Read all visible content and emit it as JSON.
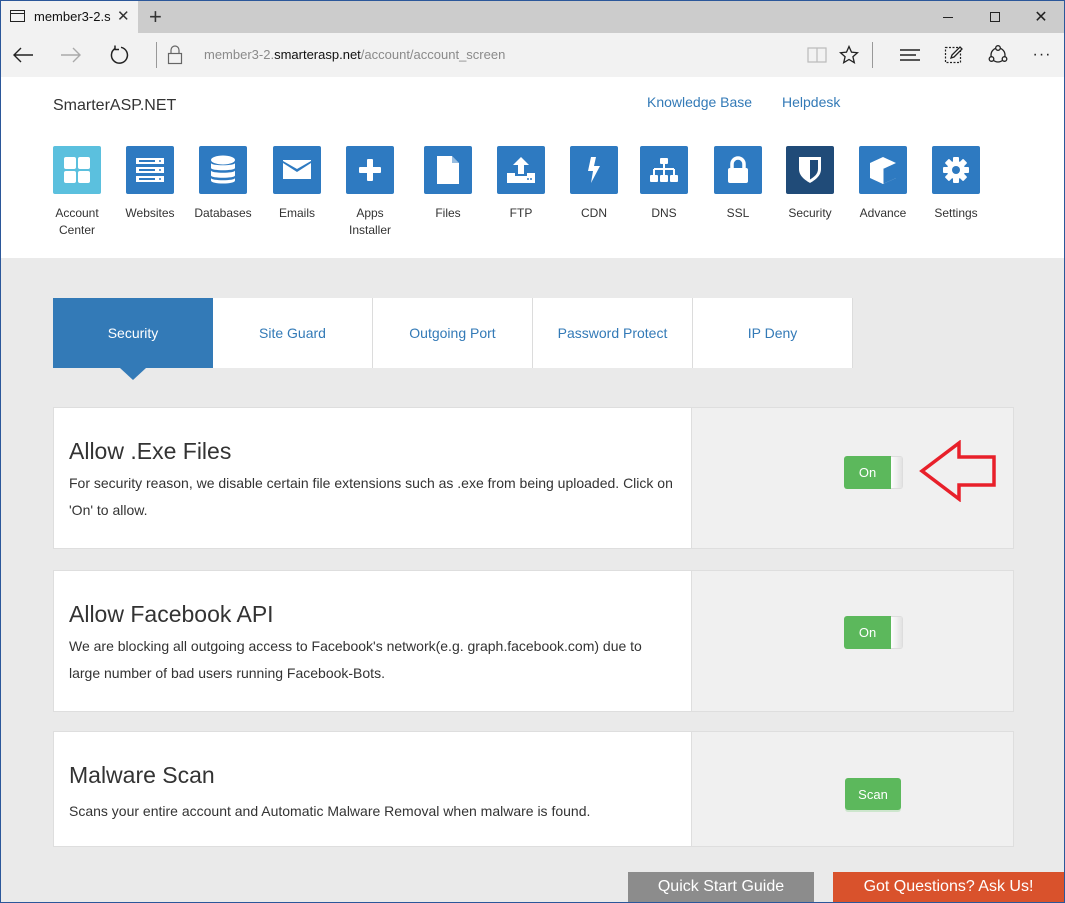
{
  "browser": {
    "tab_title": "member3-2.s",
    "url_prefix": "member3-2.",
    "url_domain": "smarterasp.net",
    "url_path": "/account/account_screen",
    "icons": {
      "back": "back-arrow-icon",
      "forward": "forward-arrow-icon",
      "refresh": "refresh-icon",
      "lock": "lock-icon",
      "reading_view": "reading-view-icon",
      "favorite": "star-icon",
      "hub": "hub-icon",
      "web_note": "web-note-icon",
      "share": "share-icon",
      "more": "more-icon"
    }
  },
  "header": {
    "brand": "SmarterASP.NET",
    "links": {
      "knowledge_base": "Knowledge Base",
      "helpdesk": "Helpdesk"
    },
    "apps": [
      {
        "label": "Account Center",
        "icon": "grid-icon",
        "state": "light"
      },
      {
        "label": "Websites",
        "icon": "server-icon"
      },
      {
        "label": "Databases",
        "icon": "database-icon"
      },
      {
        "label": "Emails",
        "icon": "envelope-icon"
      },
      {
        "label": "Apps Installer",
        "icon": "plus-icon"
      },
      {
        "label": "Files",
        "icon": "file-icon"
      },
      {
        "label": "FTP",
        "icon": "upload-icon"
      },
      {
        "label": "CDN",
        "icon": "bolt-icon"
      },
      {
        "label": "DNS",
        "icon": "sitemap-icon"
      },
      {
        "label": "SSL",
        "icon": "lock-icon"
      },
      {
        "label": "Security",
        "icon": "shield-icon",
        "state": "active"
      },
      {
        "label": "Advance",
        "icon": "cube-icon"
      },
      {
        "label": "Settings",
        "icon": "gear-icon"
      }
    ]
  },
  "tabs": [
    {
      "label": "Security",
      "active": true
    },
    {
      "label": "Site Guard"
    },
    {
      "label": "Outgoing Port"
    },
    {
      "label": "Password Protect"
    },
    {
      "label": "IP Deny"
    }
  ],
  "panels": [
    {
      "title": "Allow .Exe Files",
      "description": "For security reason, we disable certain file extensions such as .exe from being uploaded. Click on 'On' to allow.",
      "control": "toggle",
      "control_label": "On"
    },
    {
      "title": "Allow Facebook API",
      "description": "We are blocking all outgoing access to Facebook's network(e.g. graph.facebook.com) due to large number of bad users running Facebook-Bots.",
      "control": "toggle",
      "control_label": "On"
    },
    {
      "title": "Malware Scan",
      "description": "Scans your entire account and Automatic Malware Removal when malware is found.",
      "control": "button",
      "control_label": "Scan"
    }
  ],
  "footer": {
    "quick_start": "Quick Start Guide",
    "ask_us": "Got Questions? Ask Us!"
  },
  "colors": {
    "primary": "#337ab7",
    "tile": "#2e7ac1",
    "tile_active": "#204b78",
    "tile_light": "#5bc0de",
    "success": "#5cb85c",
    "annotation_arrow": "#e8202a",
    "guide_button": "#8c8c8c",
    "ask_button": "#d9522c"
  }
}
